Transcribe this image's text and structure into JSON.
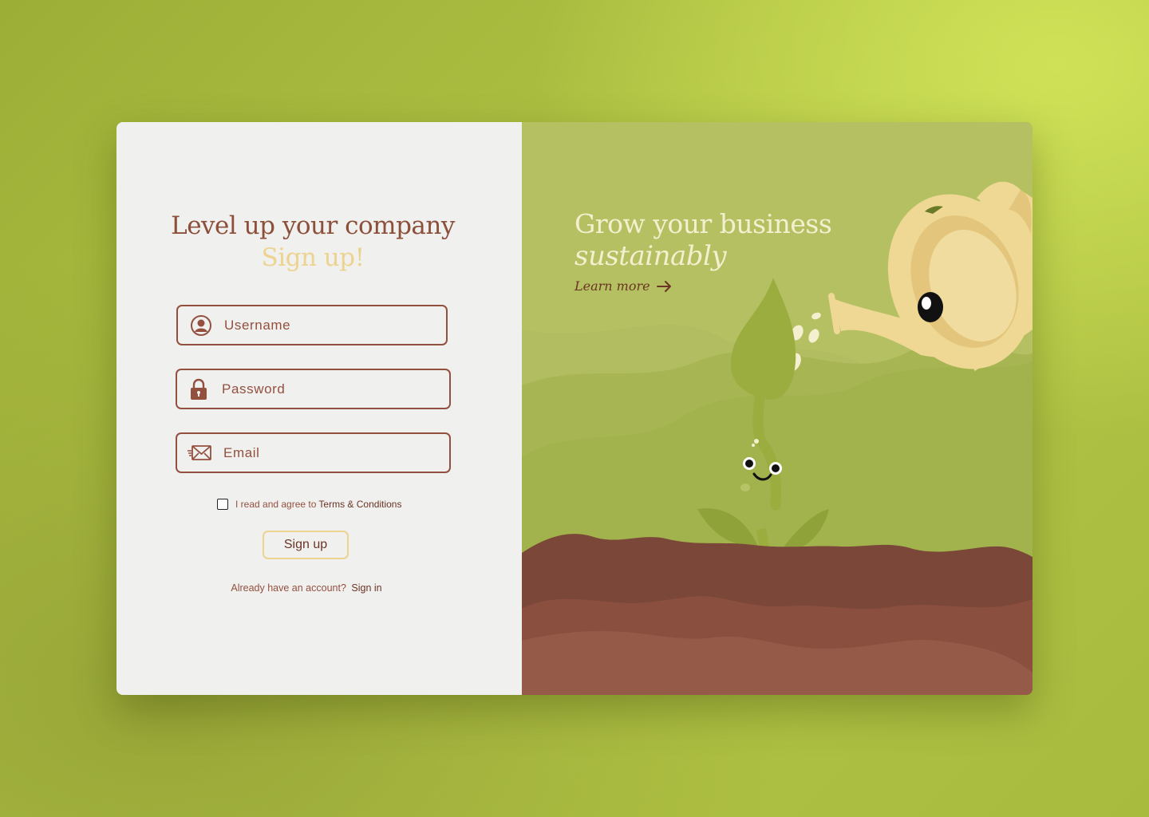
{
  "form": {
    "heading": "Level up your company",
    "subheading": "Sign up!",
    "username_placeholder": "Username",
    "password_placeholder": "Password",
    "email_placeholder": "Email",
    "agree_text": "I read and agree to",
    "terms_link": "Terms & Conditions",
    "signup_label": "Sign up",
    "already_text": "Already have an account?",
    "signin_link": "Sign in"
  },
  "promo": {
    "title": "Grow your business",
    "subtitle": "sustainably",
    "learn_more": "Learn more"
  },
  "icons": {
    "username": "user-circle-icon",
    "password": "lock-icon",
    "email": "envelope-icon",
    "learn_more": "arrow-right-icon"
  },
  "colors": {
    "brown": "#94503f",
    "dark_brown": "#6b3424",
    "cream": "#ecd38f",
    "panel_light": "#f0f0ef",
    "panel_green": "#b1bd60"
  }
}
